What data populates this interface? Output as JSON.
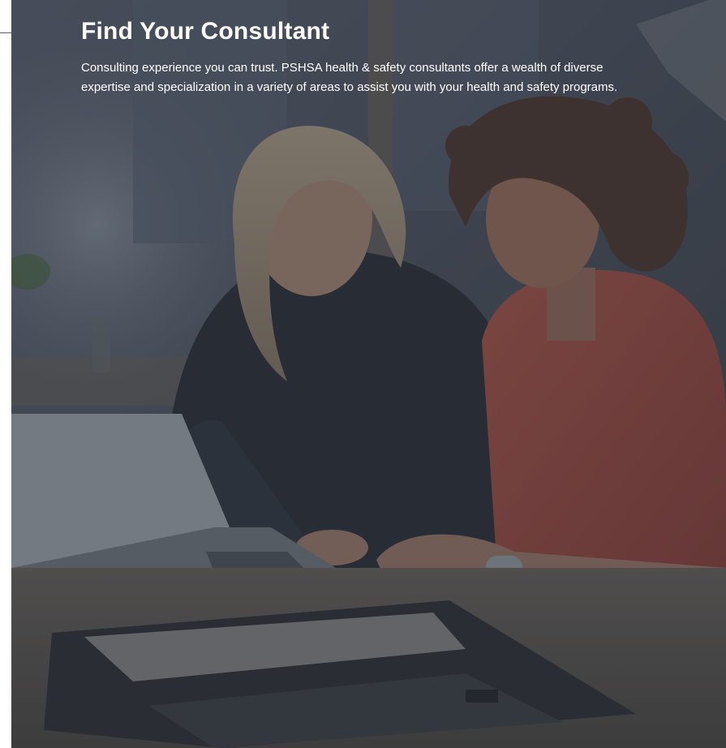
{
  "hero": {
    "title": "Find Your Consultant",
    "description": "Consulting experience you can trust. PSHSA health & safety consultants offer a wealth of diverse expertise and specialization in a variety of areas to assist you with your health and safety programs."
  },
  "colors": {
    "overlay": "#2c313c",
    "title_text": "#ffffff",
    "page_background": "#ffffff"
  }
}
